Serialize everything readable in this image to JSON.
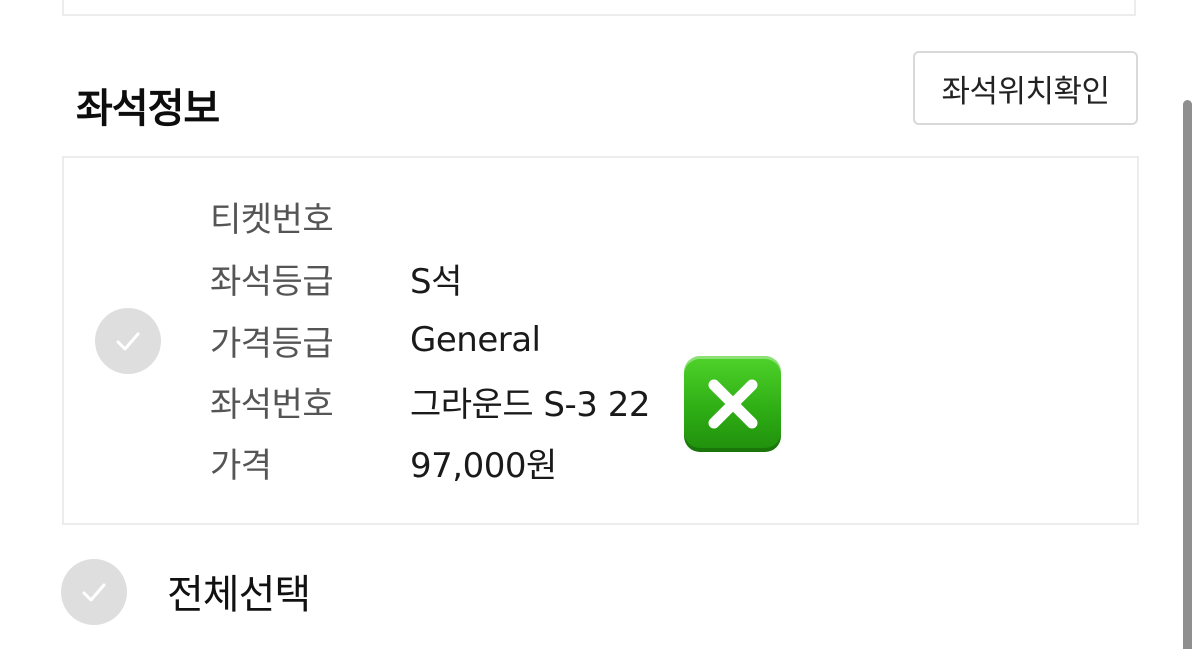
{
  "section": {
    "title": "좌석정보",
    "seat_location_button": "좌석위치확인"
  },
  "ticket": {
    "rows": [
      {
        "label": "티켓번호",
        "value": ""
      },
      {
        "label": "좌석등급",
        "value": "S석"
      },
      {
        "label": "가격등급",
        "value": "General"
      },
      {
        "label": "좌석번호",
        "value": "그라운드 S-3 22"
      },
      {
        "label": "가격",
        "value": "97,000원"
      }
    ],
    "overlay_icon": "cross-mark-button-icon"
  },
  "footer": {
    "select_all_label": "전체선택"
  },
  "colors": {
    "check_circle": "#dedede",
    "overlay_green": "#2fae15",
    "border": "#ececec"
  }
}
